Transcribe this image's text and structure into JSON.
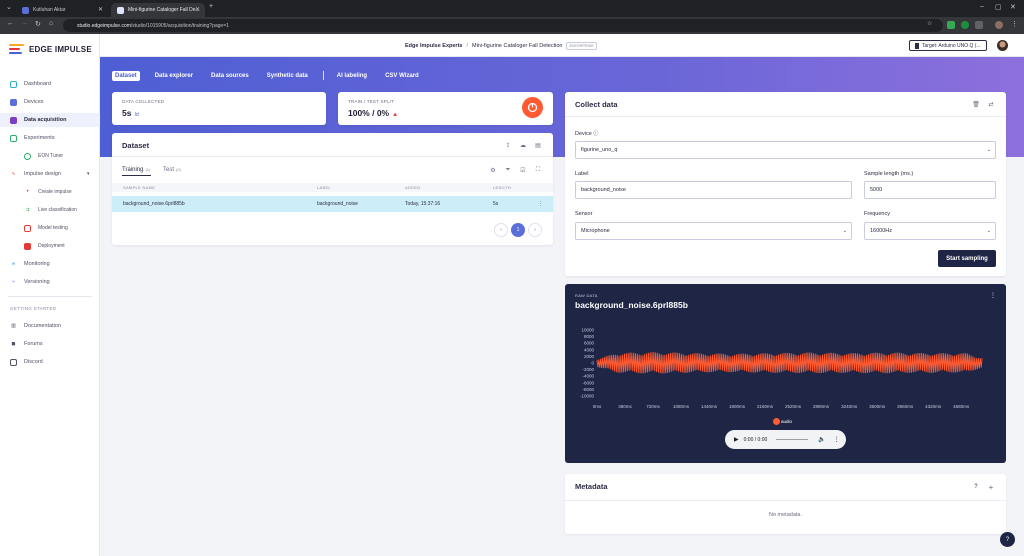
{
  "browser": {
    "tabs": [
      {
        "title": "Kutluhan Aktar"
      },
      {
        "title": "Mini-figurine Cataloger Fall De..."
      }
    ],
    "url_host": "studio.edgeimpulse.com",
    "url_path": "/studio/1015905/acquisition/training?page=1"
  },
  "sidebar": {
    "brand": "EDGE IMPULSE",
    "items": [
      {
        "label": "Dashboard",
        "icon": "monitor-icon"
      },
      {
        "label": "Devices",
        "icon": "device-icon"
      },
      {
        "label": "Data acquisition",
        "icon": "database-icon"
      },
      {
        "label": "Experiments",
        "icon": "grid-icon"
      },
      {
        "label": "EON Tuner",
        "icon": "tuner-icon"
      },
      {
        "label": "Impulse design",
        "icon": "pulse-icon"
      },
      {
        "label": "Create impulse",
        "icon": "dot-icon"
      },
      {
        "label": "Live classification",
        "icon": "flow-icon"
      },
      {
        "label": "Model testing",
        "icon": "checklist-icon"
      },
      {
        "label": "Deployment",
        "icon": "box-icon"
      },
      {
        "label": "Monitoring",
        "icon": "binoculars-icon"
      },
      {
        "label": "Versioning",
        "icon": "branch-icon"
      }
    ],
    "getting_started": "GETTING STARTED",
    "links": [
      {
        "label": "Documentation",
        "icon": "book-icon"
      },
      {
        "label": "Forums",
        "icon": "chat-icon"
      },
      {
        "label": "Discord",
        "icon": "discord-icon"
      }
    ]
  },
  "header": {
    "org": "Edge Impulse Experts",
    "separator": "/",
    "project": "Mini-figurine Cataloger Fall Detection",
    "badge": "ENTERPRISE",
    "target": "Target: Arduino UNO Q (..."
  },
  "subtabs": [
    "Dataset",
    "Data explorer",
    "Data sources",
    "Synthetic data",
    "AI labeling",
    "CSV Wizard"
  ],
  "stats": {
    "collected_label": "DATA COLLECTED",
    "collected_value": "5s",
    "collected_unit": "Id",
    "split_label": "TRAIN / TEST SPLIT",
    "split_value": "100% / 0%",
    "split_warning_icon": "warning-icon",
    "split_train_fraction": 1.0
  },
  "dataset": {
    "title": "Dataset",
    "tab_training": "Training",
    "tab_training_count": "(1)",
    "tab_test": "Test",
    "tab_test_count": "(0)",
    "columns": [
      "SAMPLE NAME",
      "LABEL",
      "ADDED",
      "LENGTH"
    ],
    "rows": [
      {
        "name": "background_noise.6prl885b",
        "label": "background_noise",
        "added": "Today, 15:37:16",
        "length": "5s"
      }
    ],
    "page": "1"
  },
  "collect": {
    "title": "Collect data",
    "device_label": "Device",
    "device_value": "figurine_uno_q",
    "label_label": "Label",
    "label_value": "background_noise",
    "length_label": "Sample length (ms.)",
    "length_value": "5000",
    "sensor_label": "Sensor",
    "sensor_value": "Microphone",
    "freq_label": "Frequency",
    "freq_value": "16000Hz",
    "start_button": "Start sampling"
  },
  "raw": {
    "label": "RAW DATA",
    "title": "background_noise.6prl885b",
    "legend": "audio",
    "player_time": "0:00 / 0:00"
  },
  "chart_data": {
    "type": "line",
    "title": "background_noise.6prl885b",
    "xlabel": "",
    "ylabel": "",
    "xlim": [
      0,
      5000
    ],
    "ylim": [
      -10000,
      10000
    ],
    "x_ticks": [
      "0ms",
      "360ms",
      "720ms",
      "1080ms",
      "1440ms",
      "1800ms",
      "2160ms",
      "2520ms",
      "2880ms",
      "3240ms",
      "3600ms",
      "3960ms",
      "4320ms",
      "4680ms"
    ],
    "y_ticks": [
      "10000",
      "8000",
      "6000",
      "4000",
      "2000",
      "0",
      "-2000",
      "-4000",
      "-6000",
      "-8000",
      "-10000"
    ],
    "series": [
      {
        "name": "audio",
        "color": "#ff5a32",
        "envelope_x": [
          0,
          250,
          500,
          750,
          1000,
          1250,
          1500,
          1750,
          2000,
          2250,
          2500,
          2750,
          3000,
          3250,
          3500,
          3750,
          4000,
          4250,
          4500,
          4750,
          4950
        ],
        "envelope_max": [
          1200,
          3000,
          3200,
          3300,
          3200,
          3000,
          2900,
          2800,
          2900,
          3000,
          3100,
          3200,
          3100,
          3000,
          3100,
          3200,
          3100,
          3000,
          3000,
          3000,
          1500
        ],
        "envelope_min": [
          -1200,
          -2900,
          -3100,
          -3200,
          -3100,
          -2900,
          -2800,
          -2800,
          -2900,
          -3000,
          -3000,
          -3100,
          -3000,
          -3000,
          -3100,
          -3100,
          -3000,
          -3000,
          -2900,
          -2900,
          -1400
        ]
      }
    ],
    "grid": false,
    "legend_position": "bottom"
  },
  "metadata": {
    "title": "Metadata",
    "empty": "No metadata."
  }
}
